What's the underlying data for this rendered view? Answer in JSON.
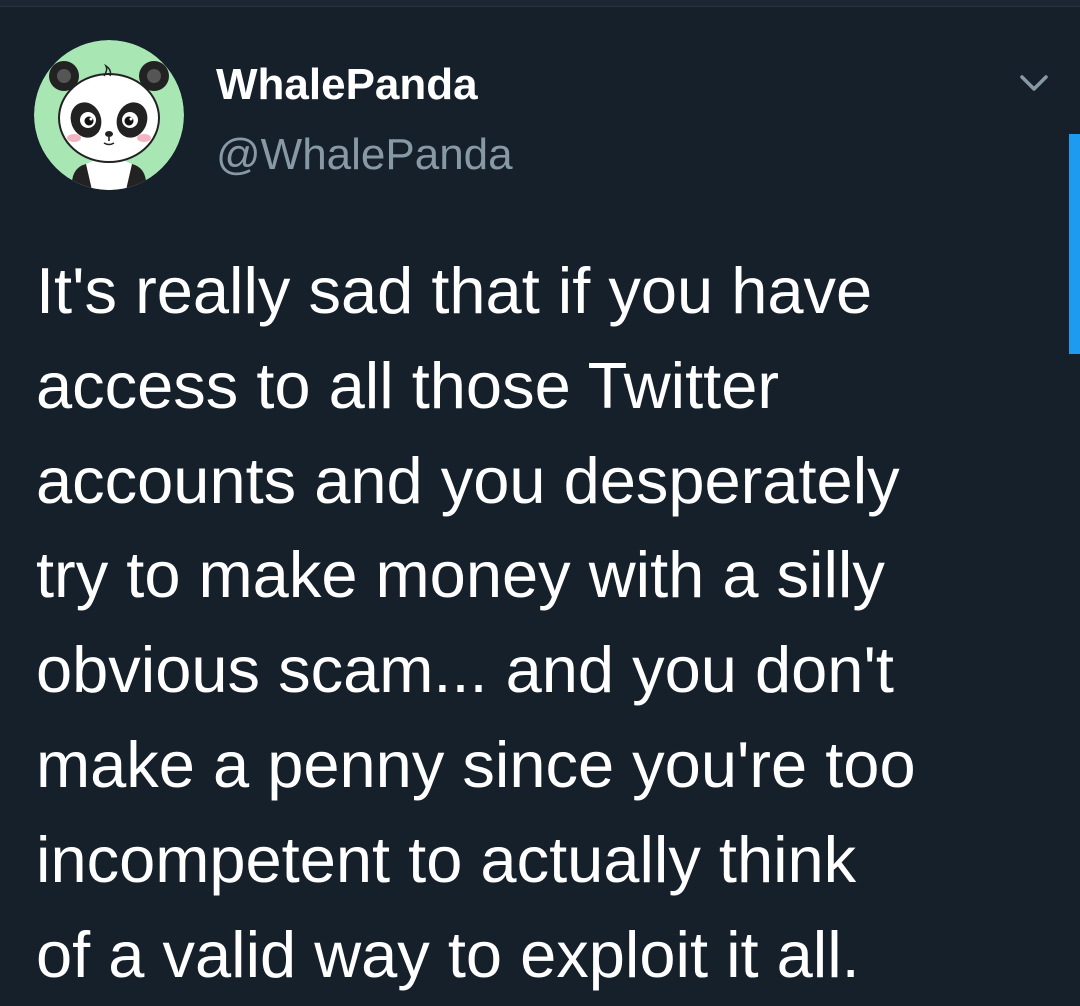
{
  "tweet": {
    "author": {
      "display_name": "WhalePanda",
      "handle": "@WhalePanda",
      "avatar_icon": "panda-avatar-icon"
    },
    "menu_icon": "chevron-down-icon",
    "text_lines": [
      "It's really sad that if you have",
      "access to all those Twitter",
      "accounts and you desperately",
      "try to make money with a silly",
      "obvious scam... and you don't",
      "make a penny since you're too",
      "incompetent to actually think",
      "of a valid way to exploit it all."
    ]
  },
  "colors": {
    "background": "#15202b",
    "text_primary": "#ffffff",
    "text_secondary": "#8899a6",
    "accent": "#1d9bf0",
    "avatar_background": "#a8e6b4"
  }
}
